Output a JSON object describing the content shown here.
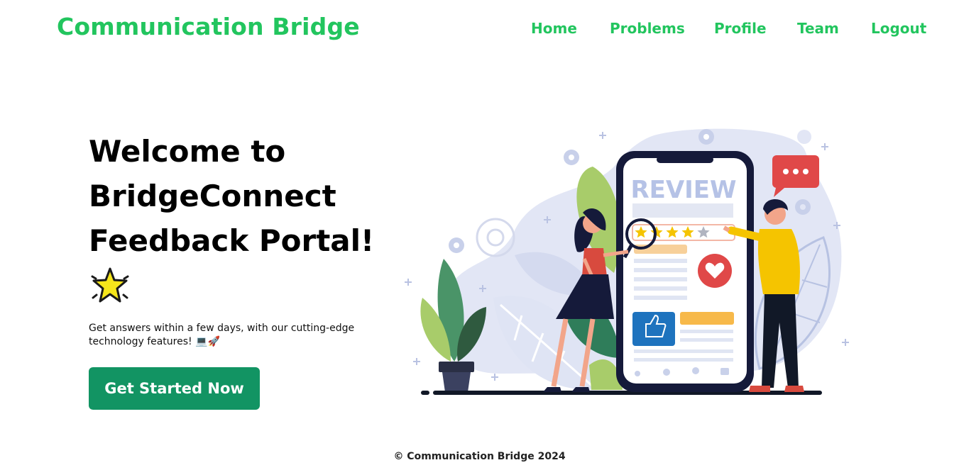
{
  "header": {
    "brand": "Communication Bridge",
    "nav": [
      {
        "label": "Home"
      },
      {
        "label": "Problems"
      },
      {
        "label": "Profile"
      },
      {
        "label": "Team"
      },
      {
        "label": "Logout"
      }
    ]
  },
  "hero": {
    "title": "Welcome to BridgeConnect Feedback Portal!",
    "subtitle": "Get answers within a few days, with our cutting-edge technology features!",
    "subtitle_emojis": "💻🚀",
    "cta_label": "Get Started Now",
    "illustration": {
      "screen_heading": "REVIEW",
      "rating": 4,
      "rating_max": 5
    }
  },
  "footer": {
    "text": "© Communication Bridge 2024"
  },
  "colors": {
    "brand_green": "#22c55e",
    "cta_green": "#129463",
    "accent_red": "#e53e3e",
    "accent_yellow": "#f5c400"
  }
}
